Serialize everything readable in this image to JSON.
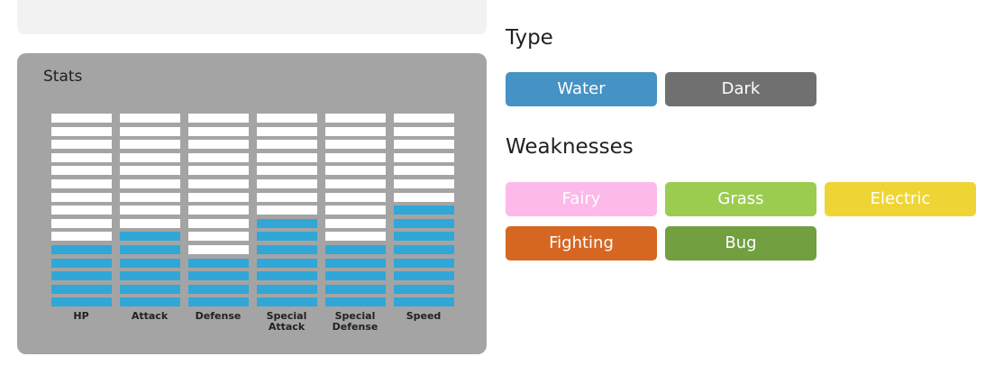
{
  "stats": {
    "title": "Stats",
    "segments_total": 15,
    "items": [
      {
        "label": "HP",
        "filled": 5
      },
      {
        "label": "Attack",
        "filled": 6
      },
      {
        "label": "Defense",
        "filled": 4
      },
      {
        "label": "Special Attack",
        "filled": 7
      },
      {
        "label": "Special Defense",
        "filled": 5
      },
      {
        "label": "Speed",
        "filled": 8
      }
    ],
    "colors": {
      "filled": "#30a7d7",
      "empty": "#ffffff"
    }
  },
  "type_section": {
    "heading": "Type",
    "items": [
      {
        "label": "Water",
        "color": "#4592c4"
      },
      {
        "label": "Dark",
        "color": "#707070"
      }
    ]
  },
  "weakness_section": {
    "heading": "Weaknesses",
    "items": [
      {
        "label": "Fairy",
        "color": "#fdb9e9"
      },
      {
        "label": "Grass",
        "color": "#9bcc50"
      },
      {
        "label": "Electric",
        "color": "#eed535"
      },
      {
        "label": "Fighting",
        "color": "#d56723"
      },
      {
        "label": "Bug",
        "color": "#729f3f"
      }
    ]
  }
}
